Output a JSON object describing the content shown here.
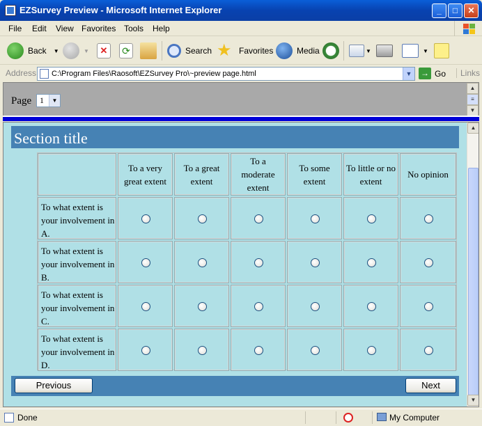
{
  "window": {
    "title": "EZSurvey Preview - Microsoft Internet Explorer",
    "buttons": {
      "minimize": "_",
      "maximize": "□",
      "close": "✕"
    }
  },
  "menu": [
    "File",
    "Edit",
    "View",
    "Favorites",
    "Tools",
    "Help"
  ],
  "toolbar": {
    "back": "Back",
    "search": "Search",
    "favorites": "Favorites",
    "media": "Media"
  },
  "address": {
    "label": "Address",
    "url": "C:\\Program Files\\Raosoft\\EZSurvey Pro\\~preview page.html",
    "go": "Go",
    "links": "Links"
  },
  "page_selector": {
    "label": "Page",
    "value": "1"
  },
  "survey": {
    "section_title": "Section title",
    "columns": [
      "To a very great extent",
      "To a great extent",
      "To a moderate extent",
      "To some extent",
      "To little or no extent",
      "No opinion"
    ],
    "rows": [
      "To what extent is your involvement in A.",
      "To what extent is your involvement in B.",
      "To what extent is your involvement in C.",
      "To what extent is your involvement in D."
    ],
    "previous": "Previous",
    "next": "Next"
  },
  "status": {
    "text": "Done",
    "zone": "My Computer"
  },
  "colors": {
    "section_bg": "#4682b4",
    "page_bg": "#b0e0e6",
    "divider": "#0000d8"
  }
}
